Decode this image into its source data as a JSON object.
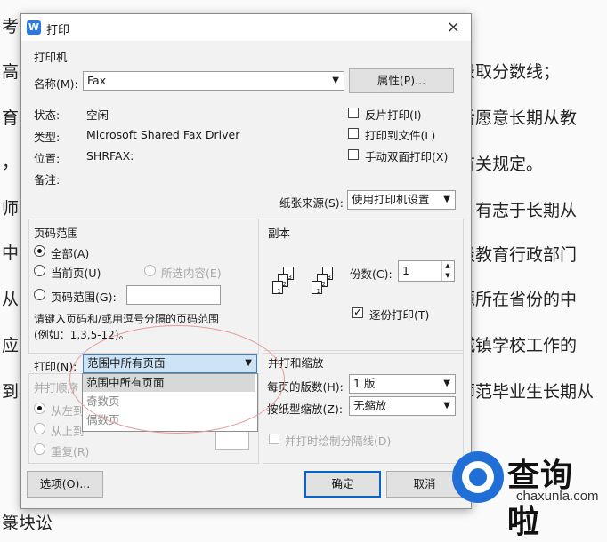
{
  "background_doc": {
    "left_lines": [
      "考",
      "高",
      "育",
      "，",
      "师",
      "中",
      "从",
      "应",
      "到",
      "箓块讼"
    ],
    "right_lines": [
      "录取分数线；",
      "后愿意长期从教",
      "有关规定。",
      "，有志于长期从",
      "级教育行政部门",
      "源所在省份的中",
      "城镇学校工作的",
      "师范毕业生长期从"
    ]
  },
  "dialog": {
    "icon_letter": "W",
    "title": "打印",
    "close": "×",
    "printer": {
      "section": "打印机",
      "name_label": "名称(M):",
      "name_value": "Fax",
      "properties_button": "属性(P)...",
      "status_label": "状态:",
      "status_value": "空闲",
      "type_label": "类型:",
      "type_value": "Microsoft Shared Fax Driver",
      "location_label": "位置:",
      "location_value": "SHRFAX:",
      "comment_label": "备注:",
      "reverse_print": "反片打印(I)",
      "print_to_file": "打印到文件(L)",
      "manual_duplex": "手动双面打印(X)",
      "paper_source_label": "纸张来源(S):",
      "paper_source_value": "使用打印机设置"
    },
    "page_range": {
      "section": "页码范围",
      "all": "全部(A)",
      "current_page": "当前页(U)",
      "selection": "所选内容(E)",
      "page_range": "页码范围(G):",
      "hint_line1": "请键入页码和/或用逗号分隔的页码范围",
      "hint_line2": "(例如：1,3,5-12)。"
    },
    "print_what": {
      "label": "打印(N):",
      "value": "范围中所有页面",
      "options": [
        "范围中所有页面",
        "奇数页",
        "偶数页"
      ]
    },
    "print_order": {
      "section": "并打顺序",
      "left_to_right": "从左到",
      "top_to_bottom": "从上到",
      "repeat": "重复(R)"
    },
    "copies": {
      "section": "副本",
      "count_label": "份数(C):",
      "count_value": "1",
      "collate": "逐份打印(T)"
    },
    "zoom": {
      "section": "并打和缩放",
      "pages_per_sheet_label": "每页的版数(H):",
      "pages_per_sheet_value": "1 版",
      "scale_label": "按纸型缩放(Z):",
      "scale_value": "无缩放",
      "draw_borders": "并打时绘制分隔线(D)"
    },
    "buttons": {
      "options": "选项(O)...",
      "ok": "确定",
      "cancel": "取消"
    }
  },
  "watermark": {
    "cn": "查询啦",
    "en": "chaxunla.com"
  }
}
